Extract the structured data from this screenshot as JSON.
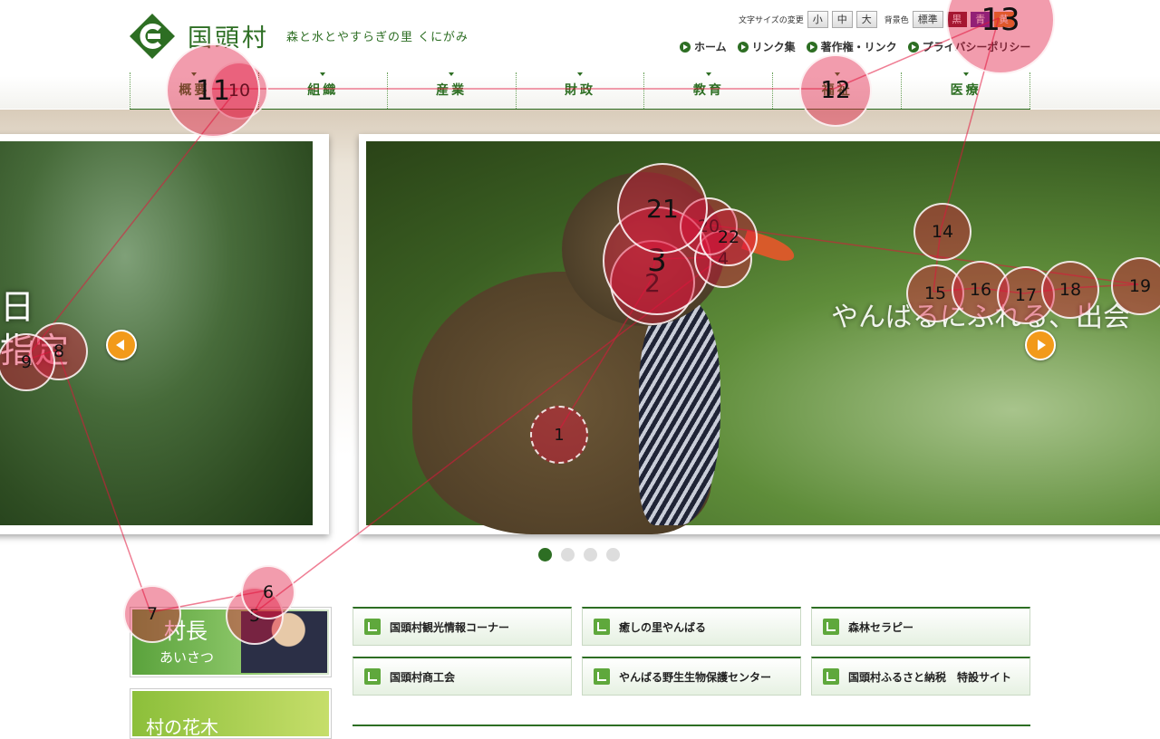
{
  "header": {
    "site_name": "国頭村",
    "tagline": "森と水とやすらぎの里 くにがみ",
    "font_size": {
      "label": "文字サイズの変更",
      "small": "小",
      "medium": "中",
      "large": "大"
    },
    "bg_color": {
      "label": "背景色",
      "standard": "標準",
      "black": "黒",
      "blue": "青",
      "yellow": "黄"
    },
    "top_links": [
      "ホーム",
      "リンク集",
      "著作権・リンク",
      "プライバシーポリシー"
    ],
    "global_nav": [
      "概要",
      "組織",
      "産業",
      "財政",
      "教育",
      "福祉",
      "医療"
    ]
  },
  "slider": {
    "left_caption": "日\n指定",
    "main_caption": "やんばるにふれる、出会",
    "slide_count": 4,
    "active_slide": 1
  },
  "side_banners": {
    "mayor_title": "村長",
    "mayor_sub": "あいさつ",
    "flower_title": "村の花木"
  },
  "links": [
    "国頭村観光情報コーナー",
    "癒しの里やんばる",
    "森林セラピー",
    "国頭村商工会",
    "やんばる野生生物保護センター",
    "国頭村ふるさと納税　特設サイト"
  ],
  "heatmap": {
    "labels": [
      "1",
      "2",
      "3",
      "4",
      "5",
      "6",
      "7",
      "8",
      "9",
      "10",
      "11",
      "12",
      "13",
      "14",
      "15",
      "16",
      "17",
      "18",
      "19",
      "20",
      "21",
      "22"
    ]
  },
  "colors": {
    "brand_green": "#2d6e23",
    "accent_orange": "#f29a1a",
    "heat_red": "#e1143c"
  }
}
